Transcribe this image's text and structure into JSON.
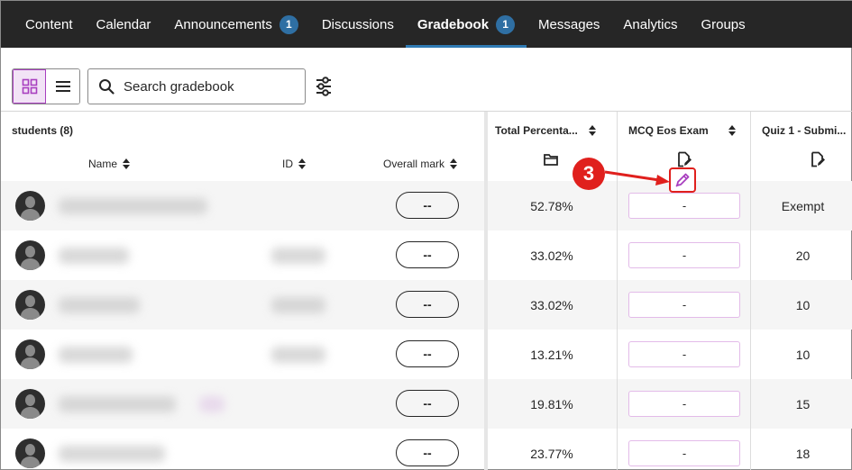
{
  "nav": {
    "tabs": [
      {
        "label": "Content"
      },
      {
        "label": "Calendar"
      },
      {
        "label": "Announcements",
        "badge": "1"
      },
      {
        "label": "Discussions"
      },
      {
        "label": "Gradebook",
        "badge": "1"
      },
      {
        "label": "Messages"
      },
      {
        "label": "Analytics"
      },
      {
        "label": "Groups"
      }
    ],
    "active": "Gradebook"
  },
  "toolbar": {
    "grid_view_icon": "grid-icon",
    "list_view_icon": "list-icon",
    "search_placeholder": "Search gradebook",
    "filter_icon": "filter-sliders-icon"
  },
  "grid": {
    "students_label": "students (8)",
    "columns": {
      "name": "Name",
      "id": "ID",
      "overall": "Overall mark",
      "total": "Total Percenta...",
      "mcq": "MCQ Eos Exam",
      "quiz": "Quiz 1 - Submi..."
    },
    "rows": [
      {
        "overall": "--",
        "total": "52.78%",
        "mcq": "-",
        "quiz": "Exempt"
      },
      {
        "overall": "--",
        "total": "33.02%",
        "mcq": "-",
        "quiz": "20"
      },
      {
        "overall": "--",
        "total": "33.02%",
        "mcq": "-",
        "quiz": "10"
      },
      {
        "overall": "--",
        "total": "13.21%",
        "mcq": "-",
        "quiz": "10"
      },
      {
        "overall": "--",
        "total": "19.81%",
        "mcq": "-",
        "quiz": "15"
      },
      {
        "overall": "--",
        "total": "23.77%",
        "mcq": "-",
        "quiz": "18"
      }
    ]
  },
  "annotation": {
    "step": "3"
  },
  "colors": {
    "accent": "#a83fbf",
    "nav_bg": "#262626",
    "badge": "#2f6fa3",
    "callout": "#e0201d"
  }
}
